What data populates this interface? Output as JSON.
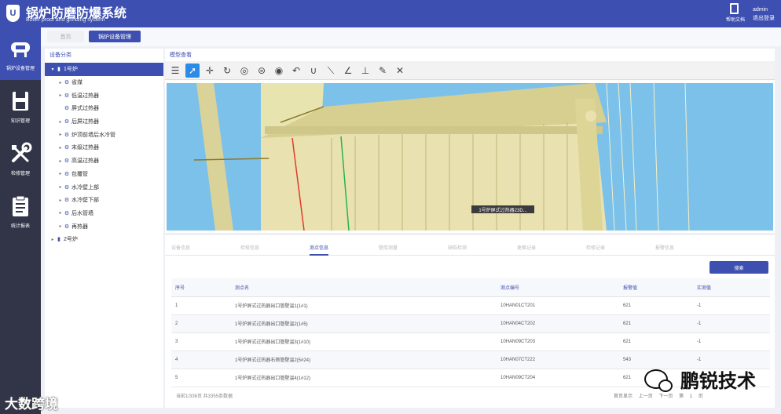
{
  "app": {
    "title": "锅炉防磨防爆系统",
    "subtitle": "Boiler proof and grinding system",
    "help_label": "帮助文档",
    "username": "admin",
    "logout_label": "退出登录",
    "logo_text": "U"
  },
  "sidebar": {
    "items": [
      {
        "label": "锅炉设备管理",
        "icon": "boiler-icon",
        "active": true
      },
      {
        "label": "知识管理",
        "icon": "save-disk-icon",
        "active": false
      },
      {
        "label": "检修管理",
        "icon": "wrench-screwdriver-icon",
        "active": false
      },
      {
        "label": "统计报表",
        "icon": "clipboard-icon",
        "active": false
      }
    ]
  },
  "tabs": [
    {
      "label": "首页"
    },
    {
      "label": "锅炉设备管理"
    }
  ],
  "tree": {
    "title": "设备分类",
    "nodes": [
      {
        "label": "1号炉",
        "level": 0,
        "selected": true,
        "expanded": true
      },
      {
        "label": "省煤",
        "level": 1
      },
      {
        "label": "低温过热器",
        "level": 1
      },
      {
        "label": "屏式过热器",
        "level": 1
      },
      {
        "label": "后屏过热器",
        "level": 1
      },
      {
        "label": "炉顶前墙后水冷管",
        "level": 1
      },
      {
        "label": "末级过热器",
        "level": 1
      },
      {
        "label": "高温过热器",
        "level": 1
      },
      {
        "label": "包覆管",
        "level": 1
      },
      {
        "label": "水冷壁上部",
        "level": 1
      },
      {
        "label": "水冷壁下部",
        "level": 1
      },
      {
        "label": "后水管墙",
        "level": 1
      },
      {
        "label": "再热器",
        "level": 1
      },
      {
        "label": "2号炉",
        "level": 0,
        "selected": false,
        "expanded": false
      }
    ]
  },
  "viewer": {
    "title": "模型查看",
    "label": "1号炉屏式过热器23D...",
    "tools": [
      "menu-icon",
      "select-arrow-icon",
      "move-icon",
      "rotate-icon",
      "target-icon",
      "section-icon",
      "eye-icon",
      "undo-icon",
      "magnet-icon",
      "measure-line-icon",
      "measure-angle-icon",
      "measure-point-icon",
      "pen-icon",
      "explode-icon"
    ]
  },
  "data": {
    "subtabs": [
      "设备信息",
      "检修信息",
      "测点信息",
      "壁厚测量",
      "缺陷检测",
      "更换记录",
      "检修记录",
      "报警信息",
      "损失信息"
    ],
    "active_subtab": 2,
    "query_label": "搜索",
    "columns": [
      "序号",
      "测点名",
      "测点编号",
      "报警值",
      "实测值"
    ],
    "rows": [
      {
        "no": "1",
        "name": "1号炉屏式过热器出口管壁温1(1#1)",
        "code": "10HAN01CT201",
        "alarm": "621",
        "value": "-1"
      },
      {
        "no": "2",
        "name": "1号炉屏式过热器出口管壁温2(1#5)",
        "code": "10HAN04CT202",
        "alarm": "621",
        "value": "-1"
      },
      {
        "no": "3",
        "name": "1号炉屏式过热器出口管壁温3(1#10)",
        "code": "10HAN09CT203",
        "alarm": "621",
        "value": "-1"
      },
      {
        "no": "4",
        "name": "1号炉屏式过热器右侧管壁温2(5#24)",
        "code": "10HAN07CT222",
        "alarm": "543",
        "value": "-1"
      },
      {
        "no": "5",
        "name": "1号炉屏式过热器出口管壁温4(1#12)",
        "code": "10HAN09CT204",
        "alarm": "621",
        "value": "-1"
      }
    ],
    "total_text": "当前1/336页 共3355条数据",
    "pager": {
      "prev": "首页显示",
      "prev2": "上一页",
      "next": "下一页",
      "page_label": "第",
      "page": "1",
      "page_suffix": "页"
    }
  },
  "watermarks": {
    "left": "大数跨境",
    "right": "鹏锐技术"
  }
}
